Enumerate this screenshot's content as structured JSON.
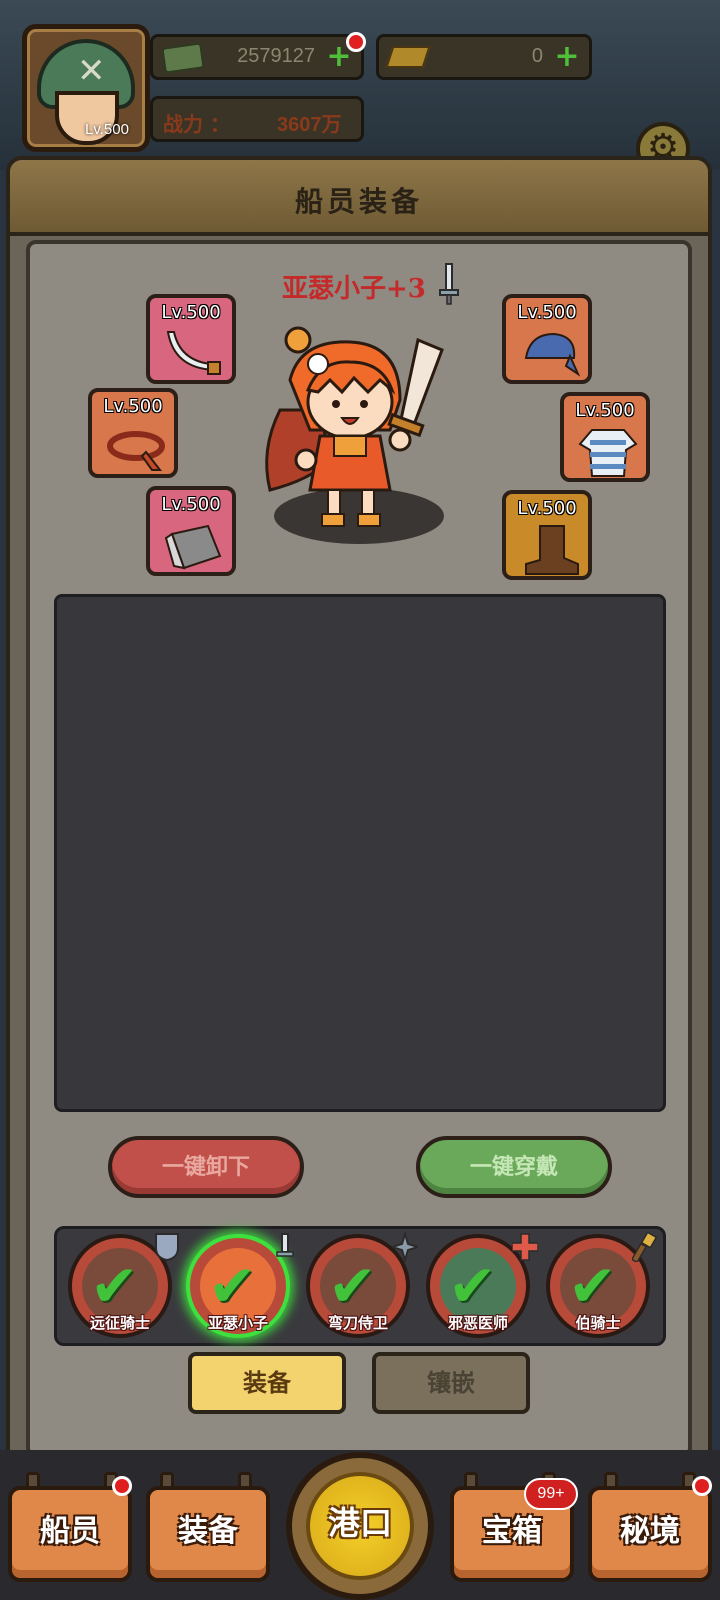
{
  "header": {
    "avatar_level": "Lv.500",
    "money": "2579127",
    "gold": "0",
    "power_label": "战力 ：",
    "power_value": "3607万",
    "settings_icon": "gear-icon"
  },
  "panel": {
    "title": "船员装备"
  },
  "hero": {
    "name": "亚瑟小子+3",
    "weapon_type_icon": "sword-icon"
  },
  "equipment": {
    "weapon": {
      "level": "Lv.500",
      "icon": "saber-icon"
    },
    "accessory": {
      "level": "Lv.500",
      "icon": "scarf-icon"
    },
    "gloves": {
      "level": "Lv.500",
      "icon": "gauntlet-icon"
    },
    "helmet": {
      "level": "Lv.500",
      "icon": "bandana-icon"
    },
    "armor": {
      "level": "Lv.500",
      "icon": "striped-shirt-icon"
    },
    "boots": {
      "level": "Lv.500",
      "icon": "boot-icon"
    }
  },
  "actions": {
    "unequip_all": "一键卸下",
    "equip_all": "一键穿戴"
  },
  "crew": [
    {
      "name": "远征骑士",
      "badge": "shield-icon"
    },
    {
      "name": "亚瑟小子",
      "badge": "sword-icon"
    },
    {
      "name": "弯刀侍卫",
      "badge": "shuriken-icon"
    },
    {
      "name": "邪恶医师",
      "badge": "cross-icon"
    },
    {
      "name": "伯骑士",
      "badge": "staff-icon"
    }
  ],
  "tabs": {
    "equip": "装备",
    "inlay": "镶嵌"
  },
  "nav": {
    "crew": "船员",
    "equipment": "装备",
    "harbor": "港口",
    "chest": "宝箱",
    "chest_badge": "99+",
    "secret": "秘境"
  },
  "colors": {
    "accent_red": "#c42a2a",
    "select_green": "#3ee03e",
    "nav_orange": "#e0884a",
    "harbor_gold": "#f4d02a"
  }
}
